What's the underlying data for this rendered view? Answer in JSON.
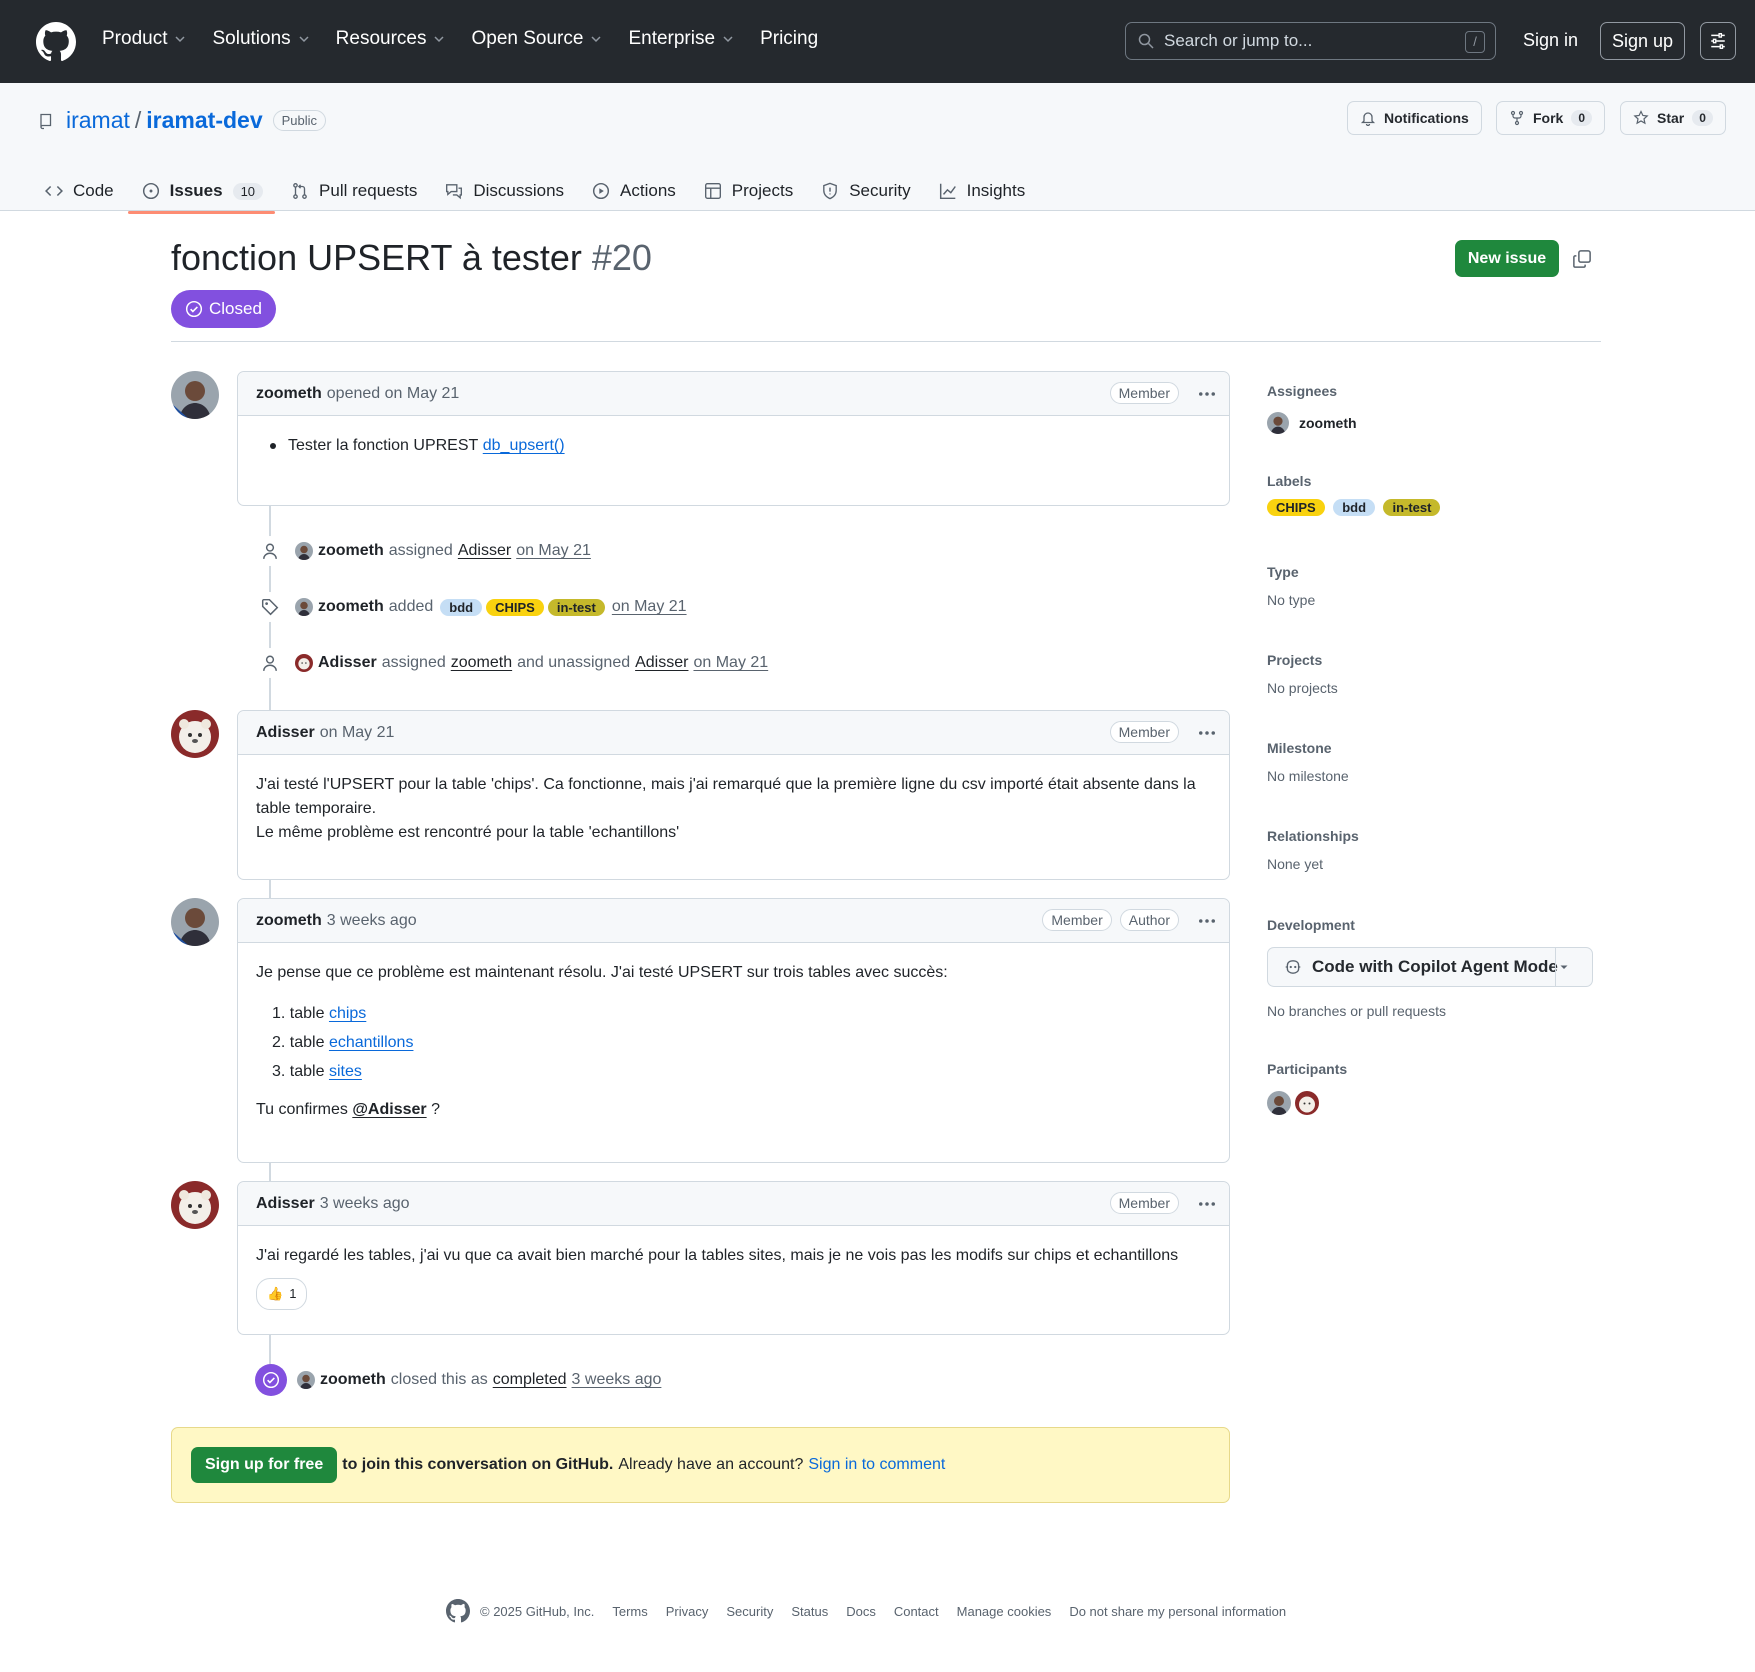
{
  "topnav": {
    "items": [
      "Product",
      "Solutions",
      "Resources",
      "Open Source",
      "Enterprise",
      "Pricing"
    ],
    "search_placeholder": "Search or jump to...",
    "search_shortcut": "/",
    "signin": "Sign in",
    "signup": "Sign up"
  },
  "repo": {
    "owner": "iramat",
    "separator": "/",
    "name": "iramat-dev",
    "visibility": "Public",
    "notifications": "Notifications",
    "fork": "Fork",
    "fork_count": "0",
    "star": "Star",
    "star_count": "0",
    "tabs": [
      {
        "label": "Code"
      },
      {
        "label": "Issues",
        "count": "10"
      },
      {
        "label": "Pull requests"
      },
      {
        "label": "Discussions"
      },
      {
        "label": "Actions"
      },
      {
        "label": "Projects"
      },
      {
        "label": "Security"
      },
      {
        "label": "Insights"
      }
    ]
  },
  "issue": {
    "title": "fonction UPSERT à tester",
    "number": "#20",
    "state": "Closed",
    "new_issue": "New issue"
  },
  "timeline": {
    "c1": {
      "author": "zoometh",
      "meta": "opened on May 21",
      "roles": [
        "Member"
      ],
      "bullet_text": "Tester la fonction UPREST",
      "bullet_link": "db_upsert()"
    },
    "e1": {
      "actor": "zoometh",
      "verb": "assigned",
      "target": "Adisser",
      "date": "on May 21"
    },
    "e2": {
      "actor": "zoometh",
      "verb": "added",
      "labels": [
        "bdd",
        "CHIPS",
        "in-test"
      ],
      "date": "on May 21"
    },
    "e3": {
      "actor": "Adisser",
      "verb": "assigned",
      "target": "zoometh",
      "mid": "and unassigned",
      "target2": "Adisser",
      "date": "on May 21"
    },
    "c2": {
      "author": "Adisser",
      "meta": "on May 21",
      "roles": [
        "Member"
      ],
      "line1": "J'ai testé l'UPSERT pour la table 'chips'. Ca fonctionne, mais j'ai remarqué que la première ligne du csv importé était absente dans la",
      "line2": "table temporaire.",
      "line3": "Le même problème est rencontré pour la table 'echantillons'"
    },
    "c3": {
      "author": "zoometh",
      "meta": "3 weeks ago",
      "roles": [
        "Member",
        "Author"
      ],
      "intro": "Je pense que ce problème est maintenant résolu. J'ai testé UPSERT sur trois tables avec succès:",
      "items": [
        {
          "n": "1.",
          "text": "table",
          "link": "chips"
        },
        {
          "n": "2.",
          "text": "table",
          "link": "echantillons"
        },
        {
          "n": "3.",
          "text": "table",
          "link": "sites"
        }
      ],
      "outro_prefix": "Tu confirmes",
      "mention": "@Adisser",
      "outro_suffix": "?"
    },
    "c4": {
      "author": "Adisser",
      "meta": "3 weeks ago",
      "roles": [
        "Member"
      ],
      "text": "J'ai regardé les tables, j'ai vu que ca avait bien marché pour la tables sites, mais je ne vois pas les modifs sur chips et echantillons",
      "reaction_emoji": "👍",
      "reaction_count": "1"
    },
    "e4": {
      "actor": "zoometh",
      "verb": "closed this as",
      "target": "completed",
      "date": "3 weeks ago"
    }
  },
  "signup_box": {
    "button": "Sign up for free",
    "strong": "to join this conversation on GitHub.",
    "text": "Already have an account?",
    "link": "Sign in to comment"
  },
  "sidebar": {
    "assignees": {
      "title": "Assignees",
      "user": "zoometh"
    },
    "labels": {
      "title": "Labels",
      "items": [
        "CHIPS",
        "bdd",
        "in-test"
      ]
    },
    "type": {
      "title": "Type",
      "value": "No type"
    },
    "projects": {
      "title": "Projects",
      "value": "No projects"
    },
    "milestone": {
      "title": "Milestone",
      "value": "No milestone"
    },
    "relationships": {
      "title": "Relationships",
      "value": "None yet"
    },
    "development": {
      "title": "Development",
      "button": "Code with Copilot Agent Mode",
      "value": "No branches or pull requests"
    },
    "participants": {
      "title": "Participants"
    }
  },
  "footer": {
    "copyright": "© 2025 GitHub, Inc.",
    "links": [
      "Terms",
      "Privacy",
      "Security",
      "Status",
      "Docs",
      "Contact",
      "Manage cookies",
      "Do not share my personal information"
    ]
  },
  "colors": {
    "header_bg": "#25292e",
    "closed": "#8250df",
    "primary_green": "#1f883d",
    "link": "#0969da",
    "label_chips": "#f9d20f",
    "label_bdd": "#c5def5",
    "label_intest": "#c5b92b"
  }
}
